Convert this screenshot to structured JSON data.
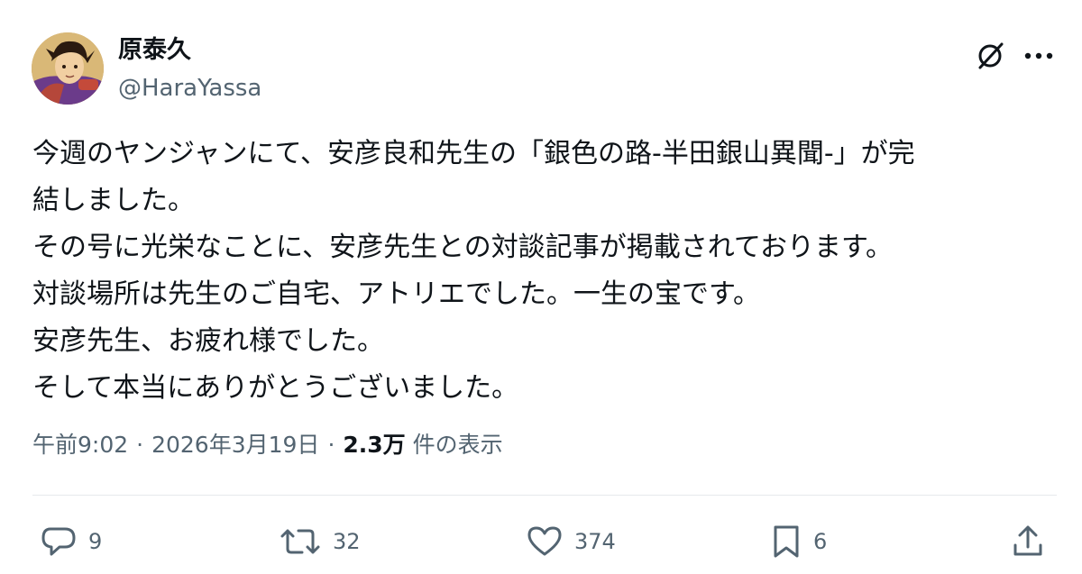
{
  "author": {
    "display_name": "原泰久",
    "handle": "@HaraYassa"
  },
  "tweet": {
    "lines": [
      "今週のヤンジャンにて、安彦良和先生の「銀色の路-半田銀山異聞-」が完",
      "結しました。",
      "その号に光栄なことに、安彦先生との対談記事が掲載されております。",
      "対談場所は先生のご自宅、アトリエでした。一生の宝です。",
      "安彦先生、お疲れ様でした。",
      "そして本当にありがとうございました。"
    ]
  },
  "meta": {
    "time": "午前9:02",
    "separator": "·",
    "date": "2026年3月19日",
    "views_count": "2.3万",
    "views_label": "件の表示"
  },
  "actions": {
    "replies": "9",
    "reposts": "32",
    "likes": "374",
    "bookmarks": "6"
  },
  "icons": {
    "grok": "grok-icon",
    "more": "more-icon",
    "reply": "reply-icon",
    "repost": "repost-icon",
    "like": "heart-icon",
    "bookmark": "bookmark-icon",
    "share": "share-icon"
  },
  "colors": {
    "text": "#0f1419",
    "secondary": "#536471",
    "divider": "#e6e9ec"
  }
}
